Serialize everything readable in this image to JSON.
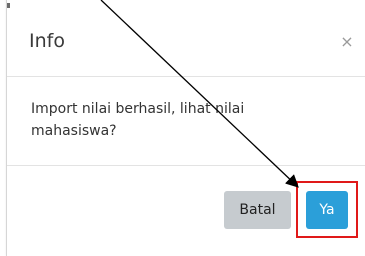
{
  "modal": {
    "title": "Info",
    "close_symbol": "×",
    "message": "Import nilai berhasil, lihat nilai mahasiswa?",
    "buttons": {
      "cancel_label": "Batal",
      "ok_label": "Ya"
    }
  },
  "annotation": {
    "arrow_icon": "arrow-icon",
    "highlight_color": "#e01919",
    "arrow_color": "#000000"
  },
  "colors": {
    "ok_button": "#2b9fd9",
    "cancel_button": "#c6cbcf"
  }
}
